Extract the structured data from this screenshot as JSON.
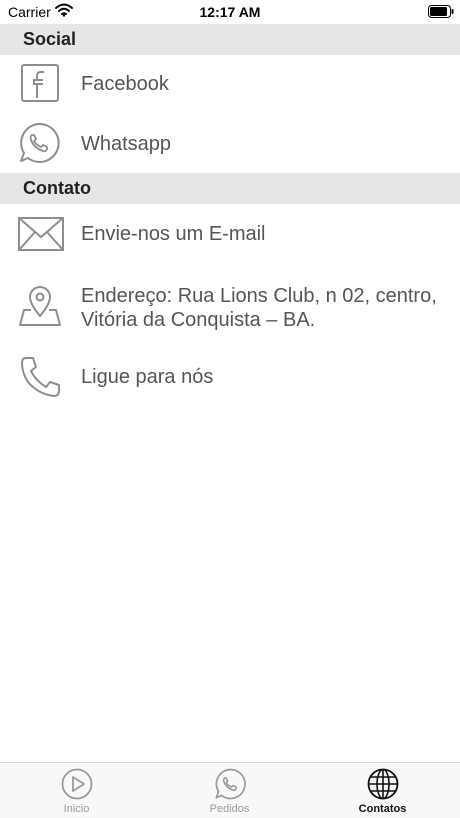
{
  "status_bar": {
    "carrier": "Carrier",
    "time": "12:17 AM"
  },
  "sections": [
    {
      "title": "Social",
      "items": [
        {
          "label": "Facebook",
          "icon": "facebook-icon"
        },
        {
          "label": "Whatsapp",
          "icon": "whatsapp-icon"
        }
      ]
    },
    {
      "title": "Contato",
      "items": [
        {
          "label": "Envie-nos um E-mail",
          "icon": "envelope-icon"
        },
        {
          "label": "Endereço: Rua Lions Club, n 02, centro,",
          "label2": "Vitória da Conquista – BA.",
          "icon": "map-pin-icon"
        },
        {
          "label": "Ligue para nós",
          "icon": "phone-icon"
        }
      ]
    }
  ],
  "tab_bar": {
    "tabs": [
      {
        "label": "Inicio",
        "icon": "play-icon",
        "active": false
      },
      {
        "label": "Pedidos",
        "icon": "whatsapp-icon",
        "active": false
      },
      {
        "label": "Contatos",
        "icon": "globe-icon",
        "active": true
      }
    ]
  },
  "colors": {
    "section_header_bg": "#e6e6e6",
    "icon_gray": "#8e8e8e",
    "label_gray": "#555555",
    "tab_inactive": "#9a9a9a",
    "tab_active": "#111111"
  }
}
